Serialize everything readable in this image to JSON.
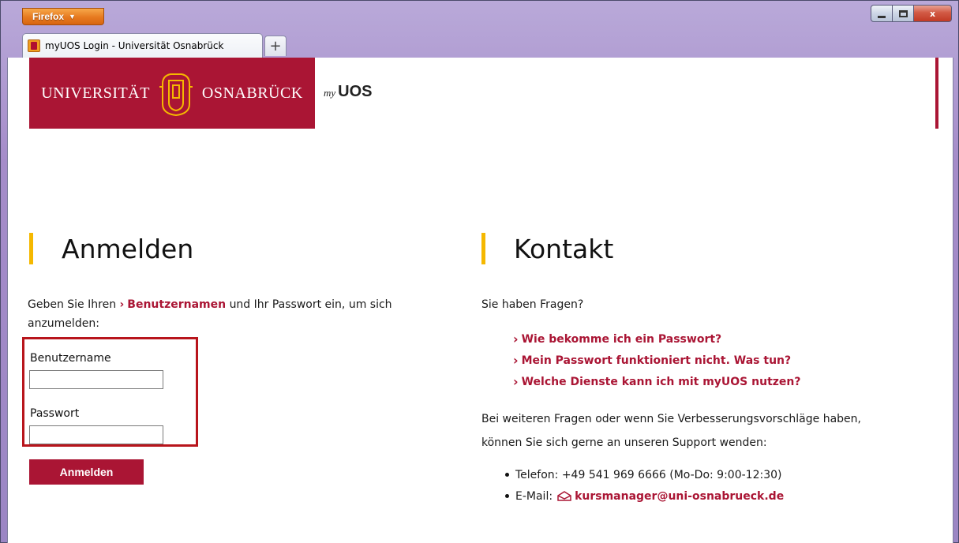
{
  "browser": {
    "menu_label": "Firefox",
    "menu_caret": "▼",
    "tab_title": "myUOS Login - Universität Osnabrück",
    "newtab_glyph": "+",
    "close_glyph": "x"
  },
  "header": {
    "logo_left": "UNIVERSITÄT",
    "logo_right": "OSNABRÜCK",
    "brand_my": "my",
    "brand_uos": "UOS"
  },
  "login": {
    "heading": "Anmelden",
    "intro_before": "Geben Sie Ihren",
    "intro_arrow": "›",
    "intro_link": "Benutzernamen",
    "intro_after": "und Ihr Passwort ein, um sich anzumelden:",
    "username_label": "Benutzername",
    "username_value": "",
    "password_label": "Passwort",
    "password_value": "",
    "submit_label": "Anmelden"
  },
  "contact": {
    "heading": "Kontakt",
    "question": "Sie haben Fragen?",
    "arrow": "›",
    "faq": [
      "Wie bekomme ich ein Passwort?",
      "Mein Passwort funktioniert nicht. Was tun?",
      "Welche Dienste kann ich mit myUOS nutzen?"
    ],
    "support_text": "Bei weiteren Fragen oder wenn Sie Verbesserungsvorschläge haben, können Sie sich gerne an unseren Support wenden:",
    "phone": "Telefon: +49 541 969 6666 (Mo-Do: 9:00-12:30)",
    "email_label": "E-Mail:",
    "email_link": "kursmanager@uni-osnabrueck.de"
  },
  "colors": {
    "brand_red": "#aa1534",
    "accent_yellow": "#f5b800",
    "highlight_box": "#b8151c"
  }
}
